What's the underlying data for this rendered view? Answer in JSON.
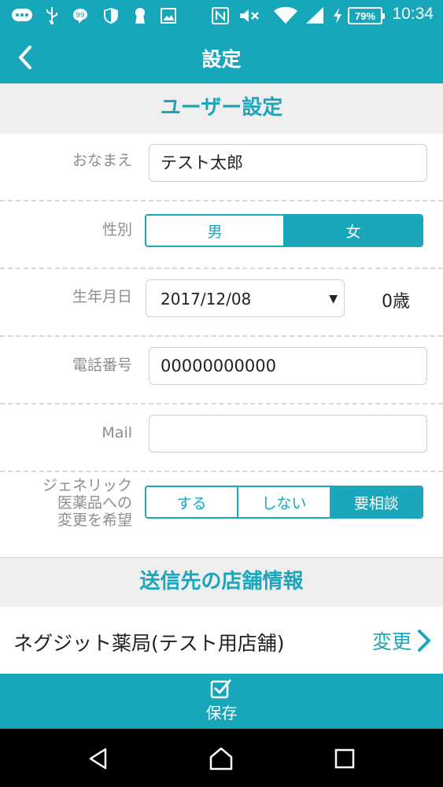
{
  "status_bar": {
    "time": "10:34",
    "battery": "79%",
    "icons": [
      "message-icon",
      "usb-icon",
      "chat-icon",
      "shield-icon",
      "keyhole-icon",
      "image-icon",
      "nfc-icon",
      "mute-icon",
      "wifi-icon",
      "signal-icon",
      "charging-icon"
    ]
  },
  "header": {
    "title": "設定",
    "back_icon": "back-chevron-icon"
  },
  "user_settings": {
    "section_title": "ユーザー設定",
    "name": {
      "label": "おなまえ",
      "value": "テスト太郎"
    },
    "gender": {
      "label": "性別",
      "options": [
        "男",
        "女"
      ],
      "selected": "女"
    },
    "birthday": {
      "label": "生年月日",
      "value": "2017/12/08",
      "age": "0歳"
    },
    "phone": {
      "label": "電話番号",
      "value": "00000000000"
    },
    "mail": {
      "label": "Mail",
      "value": ""
    },
    "generic": {
      "label_lines": [
        "ジェネリック",
        "医薬品への",
        "変更を希望"
      ],
      "options": [
        "する",
        "しない",
        "要相談"
      ],
      "selected": "要相談"
    }
  },
  "store_info": {
    "section_title": "送信先の店舗情報",
    "store_name": "ネグジット薬局(テスト用店舗)",
    "change_label": "変更"
  },
  "save": {
    "label": "保存"
  },
  "colors": {
    "accent": "#17a7bb",
    "section_bg": "#efefef",
    "label_gray": "#8e8e8e"
  }
}
